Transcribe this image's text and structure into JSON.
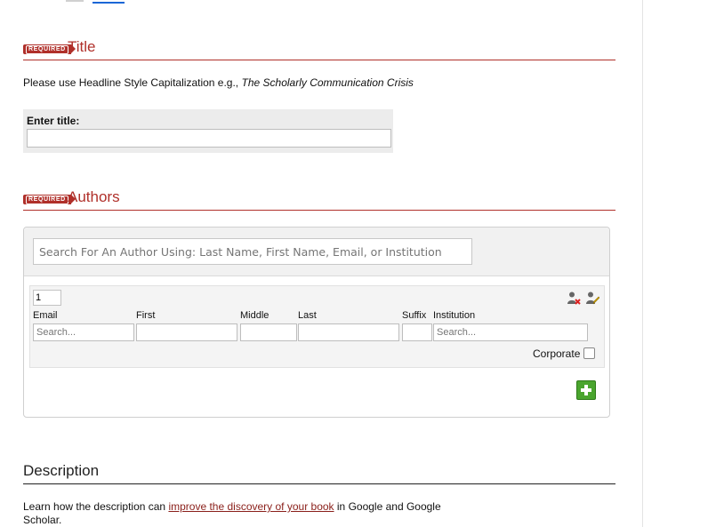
{
  "title_section": {
    "badge": "REQUIRED",
    "heading": "Title",
    "help_prefix": "Please use Headline Style Capitalization e.g.,",
    "help_example": "The Scholarly Communication Crisis",
    "field_label": "Enter title:",
    "field_value": ""
  },
  "authors_section": {
    "badge": "REQUIRED",
    "heading": "Authors",
    "search_placeholder": "Search For An Author Using: Last Name, First Name, Email, or Institution",
    "author_row": {
      "order": "1",
      "columns": {
        "email": "Email",
        "first": "First",
        "middle": "Middle",
        "last": "Last",
        "suffix": "Suffix",
        "institution": "Institution"
      },
      "email_placeholder": "Search...",
      "institution_placeholder": "Search...",
      "corporate_label": "Corporate",
      "corporate_checked": false
    },
    "add_button_icon": "plus-icon"
  },
  "description_section": {
    "heading": "Description",
    "text_before": "Learn how the description can",
    "link_text": "improve the discovery of your book",
    "text_after": "in Google and Google Scholar."
  },
  "colors": {
    "accent_red": "#b0302a",
    "link_red": "#8a1f1a",
    "add_green": "#4aa52e"
  }
}
